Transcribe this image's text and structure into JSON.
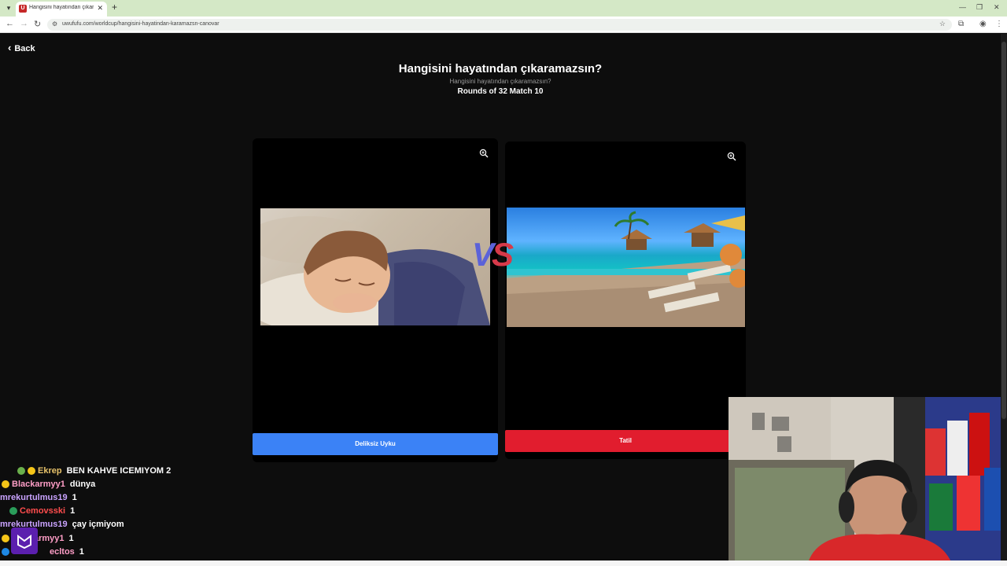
{
  "browser": {
    "tab_title": "Hangisini hayatından çıkarama...",
    "tab_favicon": "U",
    "url": "uwufufu.com/worldcup/hangisini-hayatindan-karamazsn-canovar",
    "new_tab": "+",
    "close": "✕",
    "minimize": "—",
    "restore": "❐",
    "close_window": "✕"
  },
  "page": {
    "back_label": "Back",
    "title": "Hangisini hayatından çıkaramazsın?",
    "subtitle": "Hangisini hayatından çıkaramazsın?",
    "round": "Rounds of 32 Match 10",
    "vs_v": "V",
    "vs_s": "S"
  },
  "choices": [
    {
      "label": "Deliksiz Uyku",
      "color": "#3b82f6",
      "image": "sleeping-child"
    },
    {
      "label": "Tatil",
      "color": "#e11d2e",
      "image": "tropical-resort"
    }
  ],
  "chat": [
    {
      "user": "Ekrep",
      "message": "BEN KAHVE ICEMIYOM 2",
      "color": "#e8c36a",
      "badges": [
        "gem",
        "coin"
      ]
    },
    {
      "user": "Blackarmyy1",
      "message": "dünya",
      "color": "#ff9ec7",
      "badges": [
        "coin"
      ]
    },
    {
      "user": "mrekurtulmus19",
      "message": "1",
      "color": "#c9a3ff",
      "badges": []
    },
    {
      "user": "Cemovsski",
      "message": "1",
      "color": "#ff4d4d",
      "badges": [
        "earth"
      ]
    },
    {
      "user": "mrekurtulmus19",
      "message": "çay içmiyom",
      "color": "#c9a3ff",
      "badges": []
    },
    {
      "user": "armyy1",
      "message": "1",
      "color": "#ff9ec7",
      "badges": [
        "coin"
      ]
    },
    {
      "user": "ecltos",
      "message": "1",
      "color": "#ff9ec7",
      "badges": []
    }
  ],
  "colors": {
    "background": "#0d0d0d",
    "accent_blue": "#3b82f6",
    "accent_red": "#e11d2e",
    "vs_blue": "#5b62d8",
    "vs_red": "#d63a4a"
  }
}
